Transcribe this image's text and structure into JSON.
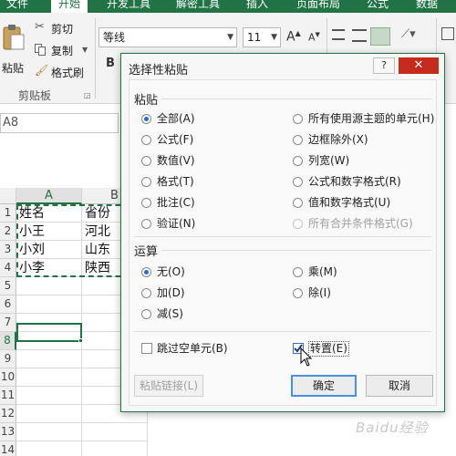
{
  "ribbon_tabs": [
    "文件",
    "开始",
    "开发工具",
    "解密工具",
    "插入",
    "页面布局",
    "公式",
    "数据"
  ],
  "clipboard": {
    "paste_label": "粘贴",
    "cut_label": "剪切",
    "copy_label": "复制",
    "format_painter_label": "格式刷",
    "group_label": "剪贴板"
  },
  "font": {
    "name": "等线",
    "size": "11",
    "bold": "B"
  },
  "name_box": "A8",
  "grid": {
    "columns": [
      "A",
      "B"
    ],
    "rows": [
      "1",
      "2",
      "3",
      "4",
      "5",
      "6",
      "7",
      "8",
      "9",
      "10",
      "11",
      "12",
      "13",
      "14"
    ],
    "cells": {
      "a1": "姓名",
      "b1": "省份",
      "a2": "小王",
      "b2": "河北",
      "a3": "小刘",
      "b3": "山东",
      "a4": "小李",
      "b4": "陕西"
    }
  },
  "dialog": {
    "title": "选择性粘贴",
    "help": "?",
    "close": "✕",
    "paste_section": "粘贴",
    "paste_options": [
      {
        "label": "全部(A)",
        "checked": true,
        "disabled": false
      },
      {
        "label": "公式(F)",
        "checked": false,
        "disabled": false
      },
      {
        "label": "数值(V)",
        "checked": false,
        "disabled": false
      },
      {
        "label": "格式(T)",
        "checked": false,
        "disabled": false
      },
      {
        "label": "批注(C)",
        "checked": false,
        "disabled": false
      },
      {
        "label": "验证(N)",
        "checked": false,
        "disabled": false
      },
      {
        "label": "所有使用源主题的单元(H)",
        "checked": false,
        "disabled": false
      },
      {
        "label": "边框除外(X)",
        "checked": false,
        "disabled": false
      },
      {
        "label": "列宽(W)",
        "checked": false,
        "disabled": false
      },
      {
        "label": "公式和数字格式(R)",
        "checked": false,
        "disabled": false
      },
      {
        "label": "值和数字格式(U)",
        "checked": false,
        "disabled": false
      },
      {
        "label": "所有合并条件格式(G)",
        "checked": false,
        "disabled": true
      }
    ],
    "operation_section": "运算",
    "operation_options": [
      {
        "label": "无(O)",
        "checked": true
      },
      {
        "label": "加(D)",
        "checked": false
      },
      {
        "label": "减(S)",
        "checked": false
      },
      {
        "label": "乘(M)",
        "checked": false
      },
      {
        "label": "除(I)",
        "checked": false
      }
    ],
    "skip_blanks": {
      "label": "跳过空单元(B)",
      "checked": false
    },
    "transpose": {
      "label": "转置(E)",
      "checked": true
    },
    "paste_link_button": "粘贴链接(L)",
    "ok_button": "确定",
    "cancel_button": "取消"
  },
  "colors": {
    "excel_green": "#217346",
    "close_red": "#c42b1c",
    "accent_blue": "#1e6fd0"
  },
  "watermark": "Baidu经验"
}
